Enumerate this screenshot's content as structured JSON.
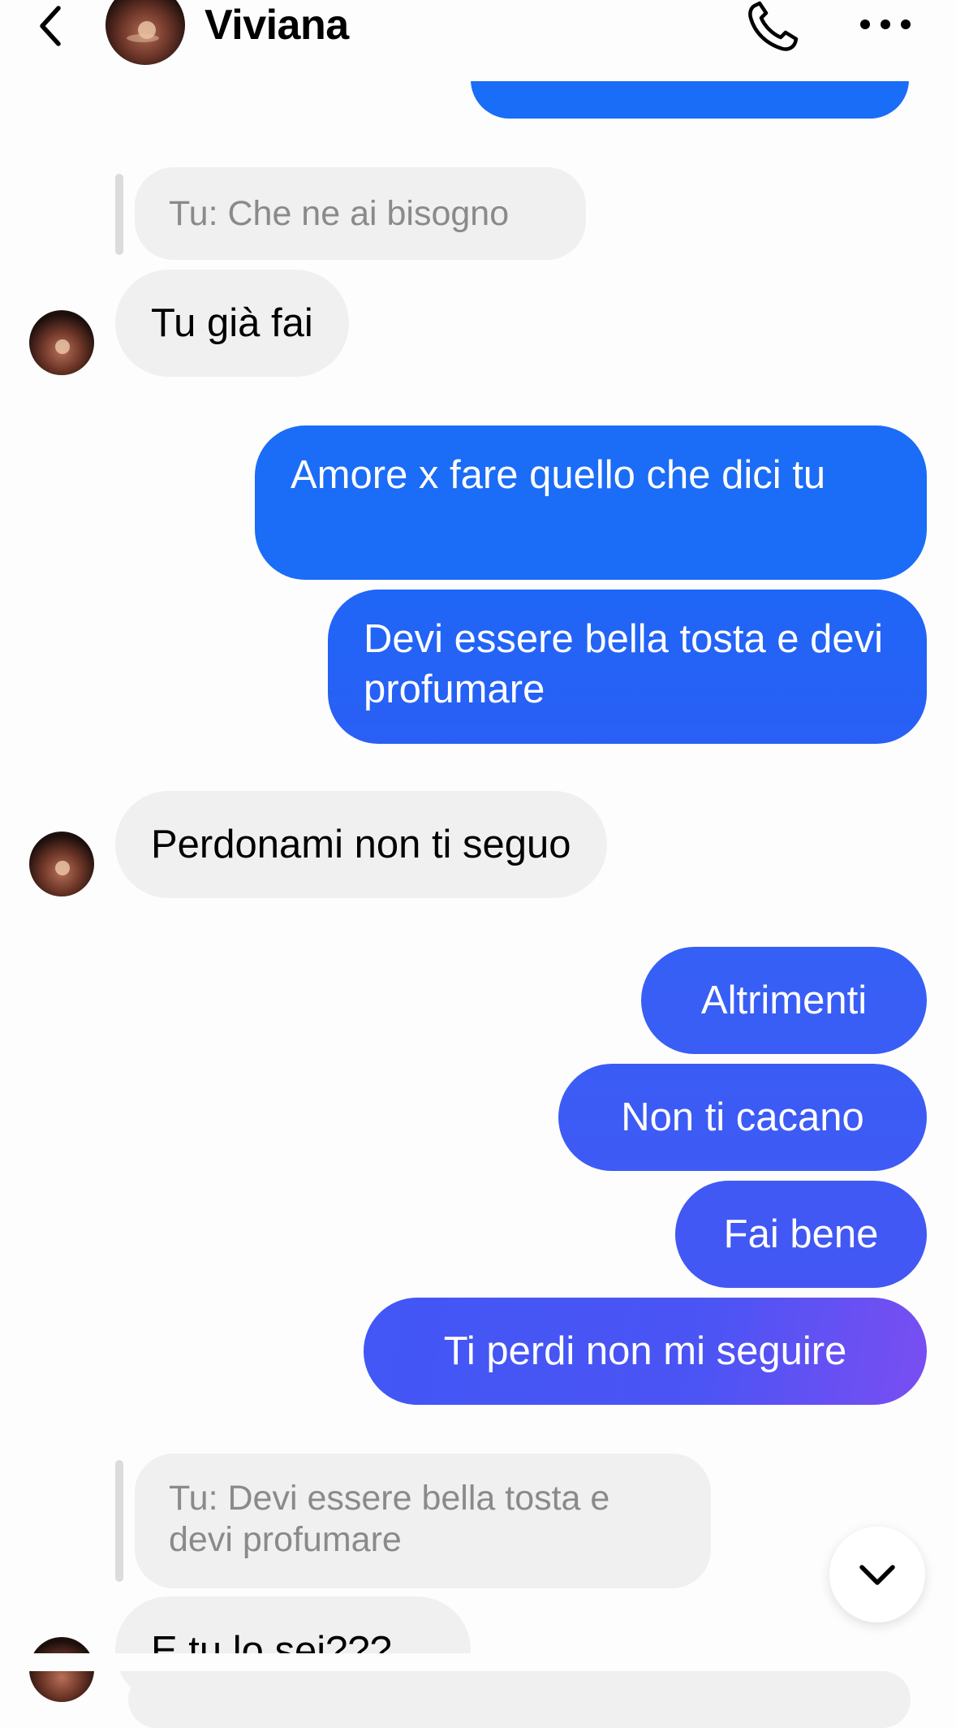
{
  "header": {
    "contact_name": "Viviana",
    "back_icon": "chevron-left-icon",
    "call_icon": "phone-icon",
    "more_icon": "more-horizontal-icon"
  },
  "messages": {
    "reply1_quote": "Tu: Che ne ai bisogno",
    "in1": "Tu già fai",
    "out1": "Amore x fare quello che dici tu",
    "out2": "Devi essere bella tosta e devi profumare",
    "in2": "Perdonami non ti seguo",
    "out3": "Altrimenti",
    "out4": "Non ti cacano",
    "out5": "Fai bene",
    "out6": "Ti perdi non mi seguire",
    "reply2_quote": "Tu: Devi essere bella tosta e devi profumare",
    "in3": "E tu lo sei???"
  },
  "controls": {
    "scroll_down_icon": "chevron-down-icon"
  },
  "colors": {
    "incoming_bubble": "#f0f0f0",
    "outgoing_top": "#1a6cf6",
    "outgoing_bottom": "#7b4ff3",
    "quote_text": "#8a8a8a"
  }
}
